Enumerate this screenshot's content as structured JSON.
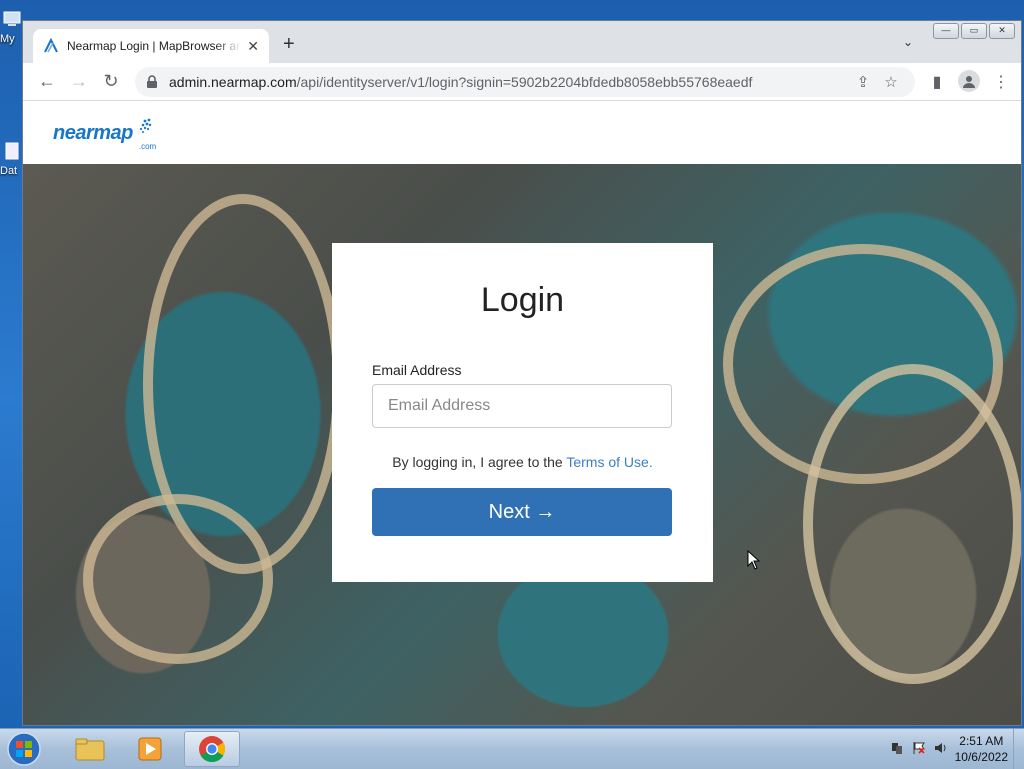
{
  "desktop": {
    "icons": [
      {
        "label": "My"
      },
      {
        "label": "Dat"
      }
    ]
  },
  "window": {
    "controls": {
      "minimize": "—",
      "maximize": "▭",
      "close": "✕"
    }
  },
  "browser": {
    "tab": {
      "title": "Nearmap Login | MapBrowser an",
      "close": "✕"
    },
    "new_tab": "+",
    "tab_menu": "⌄",
    "nav": {
      "back": "←",
      "forward": "→",
      "reload": "↻"
    },
    "url": {
      "host": "admin.nearmap.com",
      "path": "/api/identityserver/v1/login?signin=5902b2204bfdedb8058ebb55768eaedf"
    },
    "menu": "⋮"
  },
  "site": {
    "logo": {
      "name": "nearmap",
      "suffix": ".com"
    }
  },
  "login": {
    "title": "Login",
    "email_label": "Email Address",
    "email_placeholder": "Email Address",
    "email_value": "",
    "terms_prefix": "By logging in, I agree to the ",
    "terms_link": "Terms of Use.",
    "next_label": "Next →"
  },
  "taskbar": {
    "apps": [
      "file-explorer",
      "media-player",
      "chrome"
    ],
    "clock": {
      "time": "2:51 AM",
      "date": "10/6/2022"
    }
  }
}
